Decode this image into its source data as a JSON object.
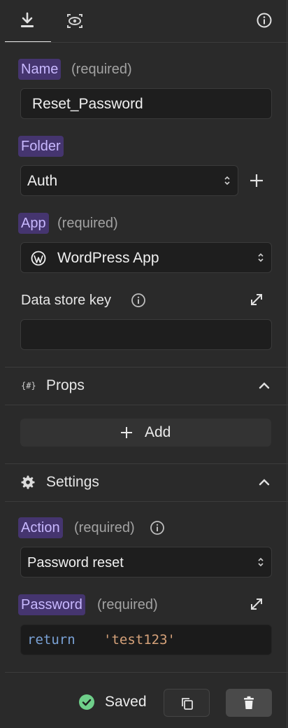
{
  "header": {
    "tabs": [
      {
        "icon": "download-icon",
        "active": true
      },
      {
        "icon": "eye-code-icon",
        "active": false
      }
    ],
    "info_icon": "info-icon"
  },
  "form": {
    "name": {
      "label": "Name",
      "required": "(required)",
      "value": "Reset_Password"
    },
    "folder": {
      "label": "Folder",
      "value": "Auth"
    },
    "app": {
      "label": "App",
      "required": "(required)",
      "value": "WordPress App"
    },
    "data_store_key": {
      "label": "Data store key",
      "value": ""
    }
  },
  "props": {
    "title": "Props",
    "icon_text": "{#}",
    "add_label": "Add"
  },
  "settings": {
    "title": "Settings",
    "action": {
      "label": "Action",
      "required": "(required)",
      "value": "Password reset"
    },
    "password": {
      "label": "Password",
      "required": "(required)",
      "code_keyword": "return",
      "code_string": "'test123'"
    }
  },
  "footer": {
    "status": "Saved"
  },
  "colors": {
    "accent_chip_bg": "#45356f",
    "accent_chip_text": "#c8b8ff",
    "success": "#6fcf8a"
  }
}
